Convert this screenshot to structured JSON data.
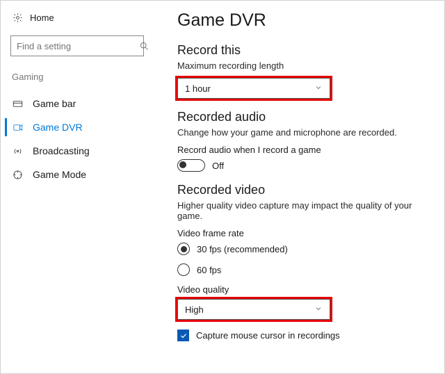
{
  "sidebar": {
    "home": "Home",
    "search_placeholder": "Find a setting",
    "group": "Gaming",
    "items": [
      {
        "label": "Game bar"
      },
      {
        "label": "Game DVR"
      },
      {
        "label": "Broadcasting"
      },
      {
        "label": "Game Mode"
      }
    ]
  },
  "page": {
    "title": "Game DVR",
    "record_this": {
      "heading": "Record this",
      "sub": "Maximum recording length",
      "value": "1 hour"
    },
    "recorded_audio": {
      "heading": "Recorded audio",
      "sub": "Change how your game and microphone are recorded.",
      "toggle_label": "Record audio when I record a game",
      "toggle_state": "Off"
    },
    "recorded_video": {
      "heading": "Recorded video",
      "sub": "Higher quality video capture may impact the quality of your game.",
      "frame_rate_label": "Video frame rate",
      "option_30": "30 fps (recommended)",
      "option_60": "60 fps",
      "quality_label": "Video quality",
      "quality_value": "High"
    },
    "capture_cursor": "Capture mouse cursor in recordings"
  }
}
